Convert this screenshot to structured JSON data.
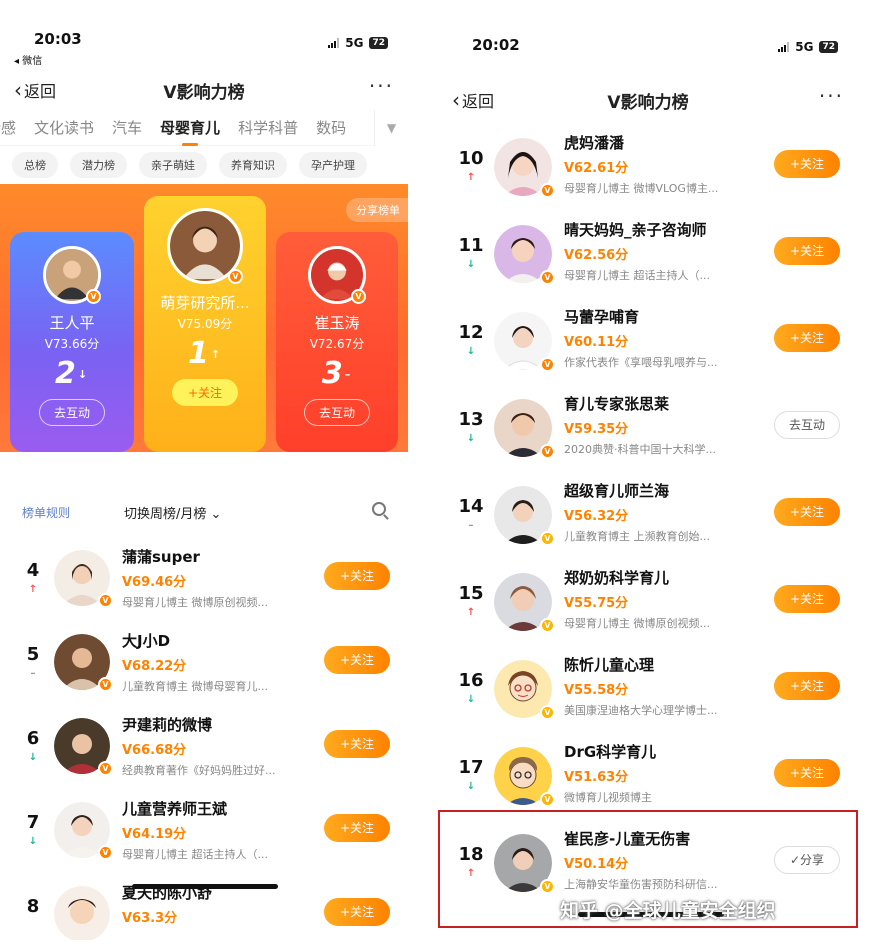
{
  "colors": {
    "accent": "#ff8200",
    "up": "#ff4d4d",
    "down": "#18b88f",
    "highlight": "#c82020"
  },
  "left": {
    "status": {
      "time": "20:03",
      "back_app": "◂ 微信",
      "network": "5G",
      "battery": "72"
    },
    "nav": {
      "back": "返回",
      "title": "V影响力榜",
      "more": "···"
    },
    "categories": [
      "情感",
      "文化读书",
      "汽车",
      "母婴育儿",
      "科学科普",
      "数码"
    ],
    "active_category": "母婴育儿",
    "subtags": [
      "总榜",
      "潜力榜",
      "亲子萌娃",
      "养育知识",
      "孕产护理"
    ],
    "share_list": "分享榜单",
    "podium": [
      {
        "rank": "2",
        "trend": "↓",
        "name": "王人平",
        "score": "V73.66分",
        "action": "去互动"
      },
      {
        "rank": "1",
        "trend": "↑",
        "name": "萌芽研究所...",
        "score": "V75.09分",
        "action": "+关注"
      },
      {
        "rank": "3",
        "trend": "–",
        "name": "崔玉涛",
        "score": "V72.67分",
        "action": "去互动"
      }
    ],
    "rule_bar": {
      "rule": "榜单规则",
      "switch": "切换周榜/月榜"
    },
    "rows": [
      {
        "num": "4",
        "trend": "↑",
        "trend_dir": "up",
        "name": "蒲蒲super",
        "score": "V69.46分",
        "desc": "母婴育儿博主 微博原创视频...",
        "action": "+关注"
      },
      {
        "num": "5",
        "trend": "–",
        "trend_dir": "same",
        "name": "大J小D",
        "score": "V68.22分",
        "desc": "儿童教育博主 微博母婴育儿...",
        "action": "+关注"
      },
      {
        "num": "6",
        "trend": "↓",
        "trend_dir": "down",
        "name": "尹建莉的微博",
        "score": "V66.68分",
        "desc": "经典教育著作《好妈妈胜过好...",
        "action": "+关注"
      },
      {
        "num": "7",
        "trend": "↓",
        "trend_dir": "down",
        "name": "儿童营养师王斌",
        "score": "V64.19分",
        "desc": "母婴育儿博主 超话主持人（...",
        "action": "+关注"
      },
      {
        "num": "8",
        "trend": "",
        "trend_dir": "same",
        "name": "夏天的陈小舒",
        "score": "V63.3分",
        "desc": "",
        "action": "+关注"
      }
    ]
  },
  "right": {
    "status": {
      "time": "20:02",
      "network": "5G",
      "battery": "72"
    },
    "nav": {
      "back": "返回",
      "title": "V影响力榜",
      "more": "···"
    },
    "rows": [
      {
        "num": "10",
        "trend": "↑",
        "trend_dir": "up",
        "name": "虎妈潘潘",
        "score": "V62.61分",
        "desc": "母婴育儿博主 微博VLOG博主...",
        "action": "+关注"
      },
      {
        "num": "11",
        "trend": "↓",
        "trend_dir": "down",
        "name": "晴天妈妈_亲子咨询师",
        "score": "V62.56分",
        "desc": "母婴育儿博主 超话主持人（...",
        "action": "+关注"
      },
      {
        "num": "12",
        "trend": "↓",
        "trend_dir": "down",
        "name": "马蕾孕哺育",
        "score": "V60.11分",
        "desc": "作家代表作《享喂母乳喂养与...",
        "action": "+关注"
      },
      {
        "num": "13",
        "trend": "↓",
        "trend_dir": "down",
        "name": "育儿专家张思莱",
        "score": "V59.35分",
        "desc": "2020典赞·科普中国十大科学...",
        "action": "去互动"
      },
      {
        "num": "14",
        "trend": "–",
        "trend_dir": "same",
        "name": "超级育儿师兰海",
        "score": "V56.32分",
        "desc": "儿童教育博主 上濒教育创始...",
        "action": "+关注"
      },
      {
        "num": "15",
        "trend": "↑",
        "trend_dir": "up",
        "name": "郑奶奶科学育儿",
        "score": "V55.75分",
        "desc": "母婴育儿博主 微博原创视频...",
        "action": "+关注"
      },
      {
        "num": "16",
        "trend": "↓",
        "trend_dir": "down",
        "name": "陈忻儿童心理",
        "score": "V55.58分",
        "desc": "美国康涅迪格大学心理学博士...",
        "action": "+关注"
      },
      {
        "num": "17",
        "trend": "↓",
        "trend_dir": "down",
        "name": "DrG科学育儿",
        "score": "V51.63分",
        "desc": "微博育儿视频博主",
        "action": "+关注"
      },
      {
        "num": "18",
        "trend": "↑",
        "trend_dir": "up",
        "name": "崔民彦-儿童无伤害",
        "score": "V50.14分",
        "desc": "上海静安华童伤害预防科研信...",
        "action": "✓分享"
      }
    ]
  },
  "watermark": "知乎 @全球儿童安全组织"
}
